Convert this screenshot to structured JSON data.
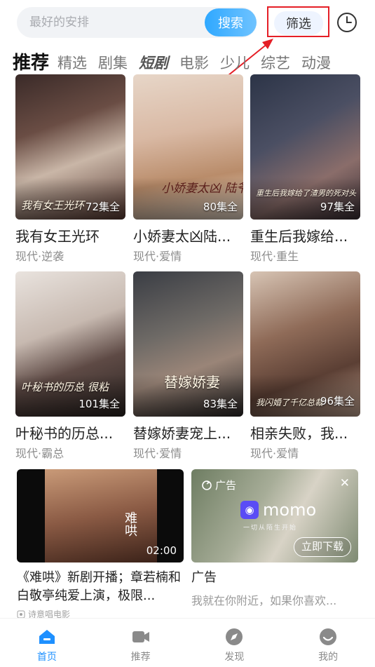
{
  "search": {
    "placeholder": "最好的安排",
    "button_label": "搜索"
  },
  "filter_label": "筛选",
  "annotation_color": "#e51e26",
  "tabs": [
    {
      "label": "推荐",
      "active": true
    },
    {
      "label": "精选"
    },
    {
      "label": "剧集"
    },
    {
      "label": "短剧",
      "style": "italic-bold"
    },
    {
      "label": "电影"
    },
    {
      "label": "少儿"
    },
    {
      "label": "综艺"
    },
    {
      "label": "动漫"
    }
  ],
  "dramas": [
    {
      "title": "我有女王光环",
      "tags": "现代·逆袭",
      "episodes": "72集全",
      "poster_text": "我有女王光环"
    },
    {
      "title": "小娇妻太凶陆...",
      "tags": "现代·爱情",
      "episodes": "80集全",
      "poster_text": "小娇妻太凶 陆爷"
    },
    {
      "title": "重生后我嫁给...",
      "tags": "现代·重生",
      "episodes": "97集全",
      "poster_text": "重生后我嫁给了渣男的死对头"
    },
    {
      "title": "叶秘书的历总...",
      "tags": "现代·霸总",
      "episodes": "101集全",
      "poster_text": "叶秘书的历总 很粘"
    },
    {
      "title": "替嫁娇妻宠上...",
      "tags": "现代·爱情",
      "episodes": "83集全",
      "poster_text": "替嫁娇妻"
    },
    {
      "title": "相亲失败，我...",
      "tags": "现代·爱情",
      "episodes": "96集全",
      "poster_text": "我闪婚了千亿总裁"
    }
  ],
  "featured_video": {
    "title": "《难哄》新剧开播；章若楠和白敬亭纯爱上演，极限...",
    "duration": "02:00",
    "source": "诗意唱电影",
    "poster_text": "难哄"
  },
  "ad": {
    "badge": "广告",
    "brand": "momo",
    "slogan": "一切从陌生开始",
    "cta": "立即下载",
    "title": "广告",
    "subtitle": "我就在你附近，如果你喜欢..."
  },
  "nav": [
    {
      "label": "首页",
      "icon": "home-icon",
      "active": true
    },
    {
      "label": "推荐",
      "icon": "video-icon"
    },
    {
      "label": "发现",
      "icon": "compass-icon"
    },
    {
      "label": "我的",
      "icon": "profile-icon"
    }
  ]
}
